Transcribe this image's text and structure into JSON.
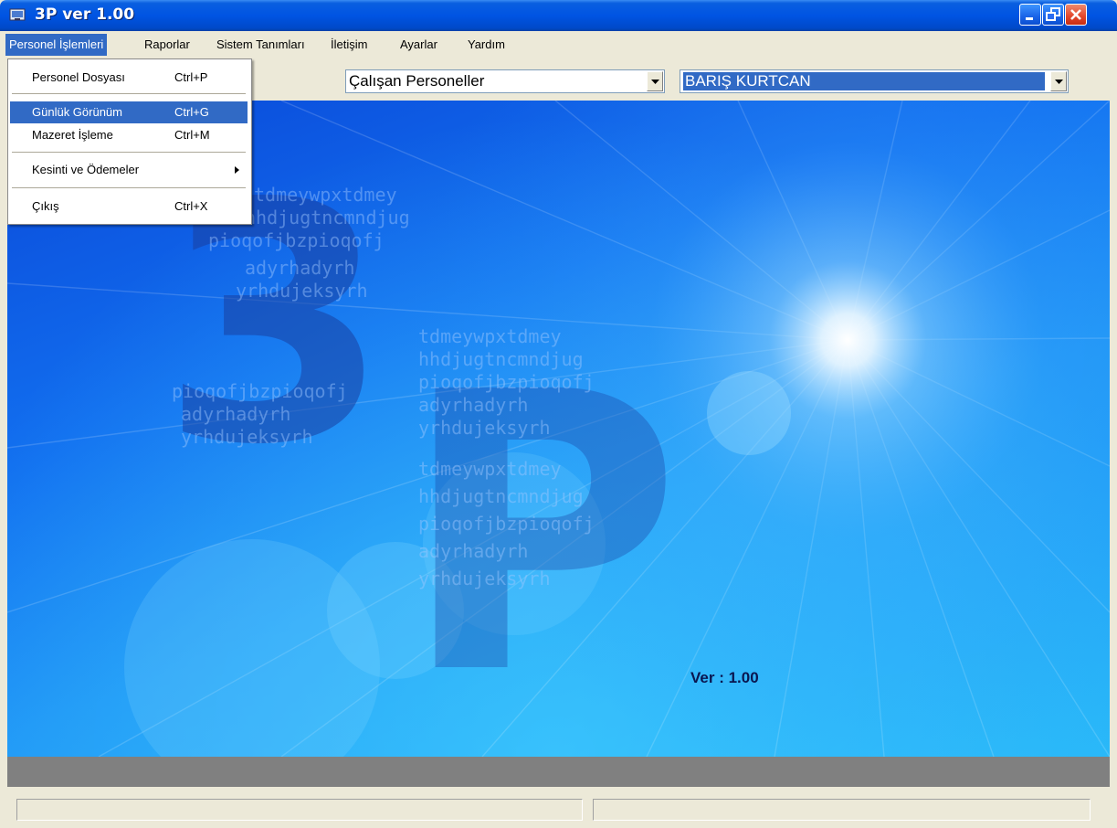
{
  "window": {
    "title": "3P ver 1.00"
  },
  "menubar": {
    "items": [
      "Personel İşlemleri",
      "Raporlar",
      "Sistem Tanımları",
      "İletişim",
      "Ayarlar",
      "Yardım"
    ]
  },
  "toolbar": {
    "personnel_filter": "Çalışan Personeller",
    "selected_employee": "BARIŞ KURTCAN"
  },
  "dropdown": {
    "items": [
      {
        "label": "Personel Dosyası",
        "shortcut": "Ctrl+P"
      },
      {
        "label": "Günlük Görünüm",
        "shortcut": "Ctrl+G"
      },
      {
        "label": "Mazeret İşleme",
        "shortcut": "Ctrl+M"
      },
      {
        "label": "Kesinti ve Ödemeler",
        "shortcut": ""
      },
      {
        "label": "Çıkış",
        "shortcut": "Ctrl+X"
      }
    ]
  },
  "splash": {
    "logo_text": "3P",
    "version_label": "Ver : 1.00",
    "pattern_lines": [
      "tdmeywpxtdmey",
      "hhdjugtncmndjug",
      "pioqofjbzpioqofj",
      "adyrhadyrh",
      "yrhdujeksyrh"
    ]
  },
  "colors": {
    "title_bar": "#0054e3",
    "menu_highlight": "#316ac5",
    "background": "#ece9d8"
  }
}
